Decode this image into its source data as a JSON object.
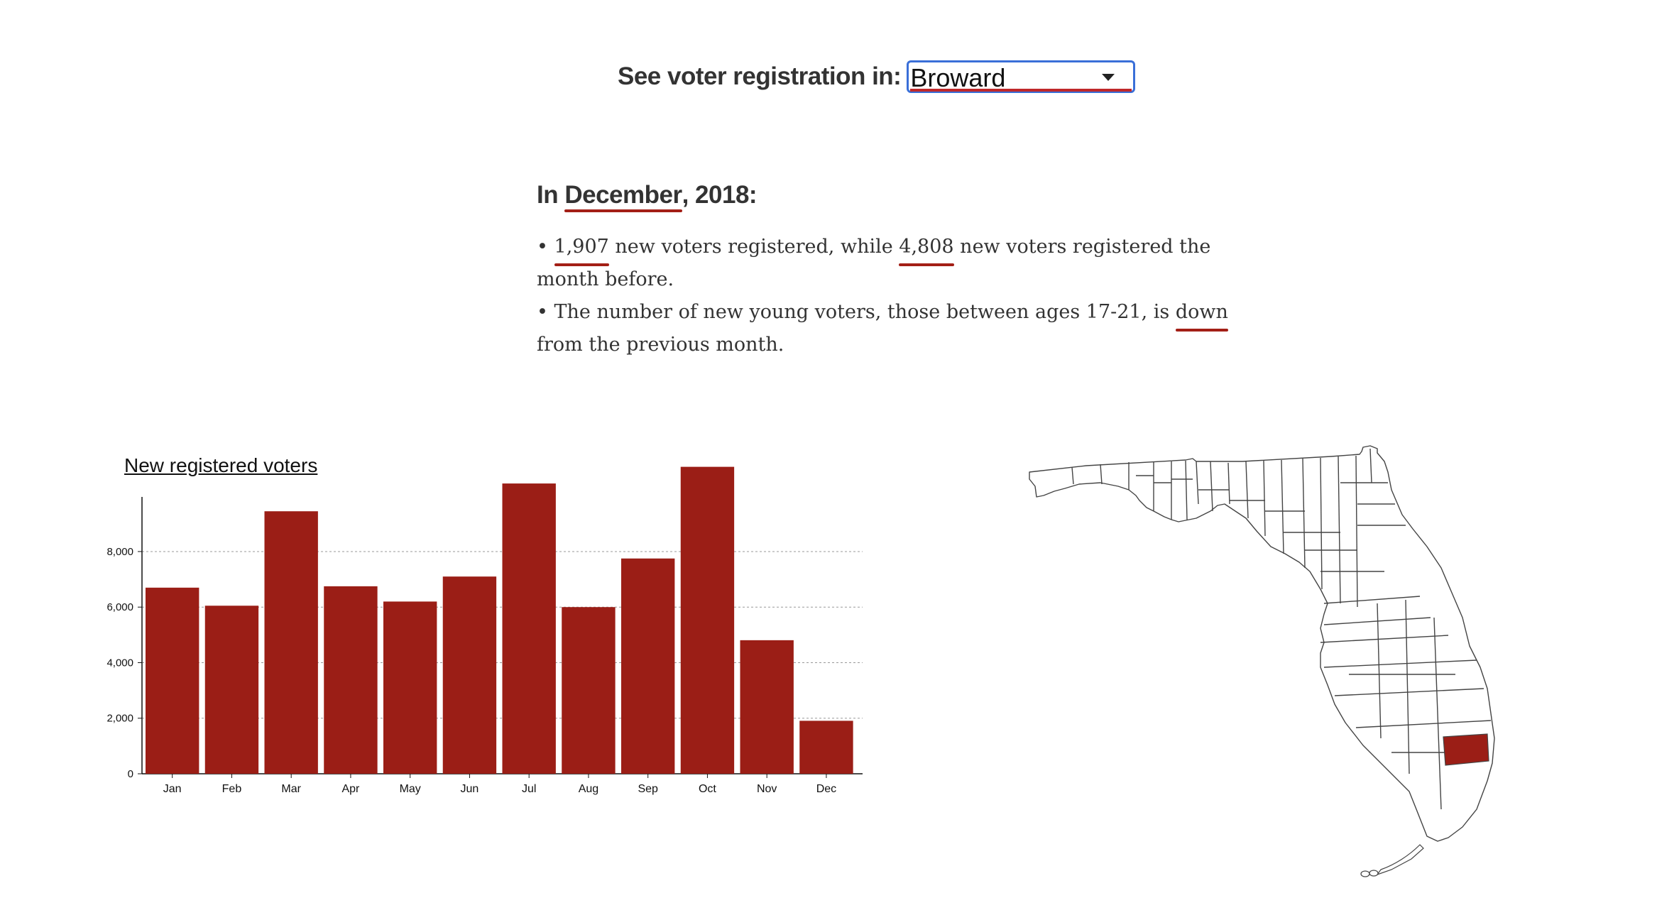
{
  "selector": {
    "label": "See voter registration in:",
    "selected": "Broward"
  },
  "summary": {
    "heading_prefix": "In ",
    "heading_month": "December",
    "heading_suffix": ", 2018:",
    "line1_bullet": "• ",
    "line1_count": "1,907",
    "line1_mid": " new voters registered, while ",
    "line1_prev": "4,808",
    "line1_end": " new voters registered the month before.",
    "line2_start": "• The number of new young voters, those between ages 17-21, is ",
    "line2_trend": "down",
    "line2_end": " from the previous month."
  },
  "chart_data": {
    "type": "bar",
    "title": "New registered voters",
    "categories": [
      "Jan",
      "Feb",
      "Mar",
      "Apr",
      "May",
      "Jun",
      "Jul",
      "Aug",
      "Sep",
      "Oct",
      "Nov",
      "Dec"
    ],
    "values": [
      6700,
      6050,
      9450,
      6750,
      6200,
      7100,
      10450,
      6000,
      7750,
      11050,
      4808,
      1907
    ],
    "yticks": [
      "0",
      "2,000",
      "4,000",
      "6,000",
      "8,000"
    ],
    "ylim": [
      0,
      11500
    ],
    "grid": true,
    "bar_color": "#9b1e16"
  },
  "map": {
    "highlighted_county": "Broward",
    "highlight_color": "#9b1e16"
  }
}
